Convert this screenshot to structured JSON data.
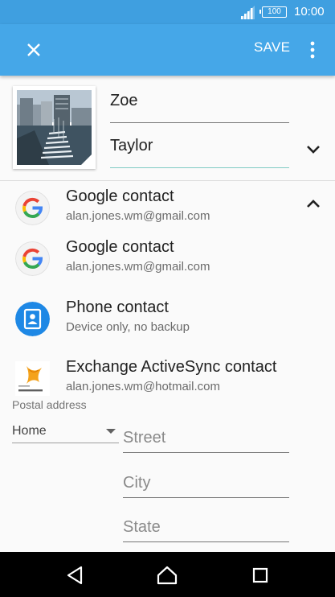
{
  "status_bar": {
    "battery": "100",
    "time": "10:00"
  },
  "app_bar": {
    "save_label": "SAVE",
    "accent_color": "#45a7e8"
  },
  "contact": {
    "first_name": "Zoe",
    "last_name": "Taylor"
  },
  "selected_account": {
    "title": "Google contact",
    "subtitle": "alan.jones.wm@gmail.com",
    "icon": "google-icon"
  },
  "account_options": [
    {
      "title": "Google contact",
      "subtitle": "alan.jones.wm@gmail.com",
      "icon": "google-icon"
    },
    {
      "title": "Phone contact",
      "subtitle": "Device only, no backup",
      "icon": "phone-contact-icon"
    },
    {
      "title": "Exchange ActiveSync contact",
      "subtitle": "alan.jones.wm@hotmail.com",
      "icon": "exchange-icon"
    }
  ],
  "postal": {
    "label": "Postal address",
    "type_value": "Home",
    "street_placeholder": "Street",
    "city_placeholder": "City",
    "state_placeholder": "State"
  },
  "nav": {
    "back": "back-icon",
    "home": "home-icon",
    "recents": "recents-icon"
  }
}
